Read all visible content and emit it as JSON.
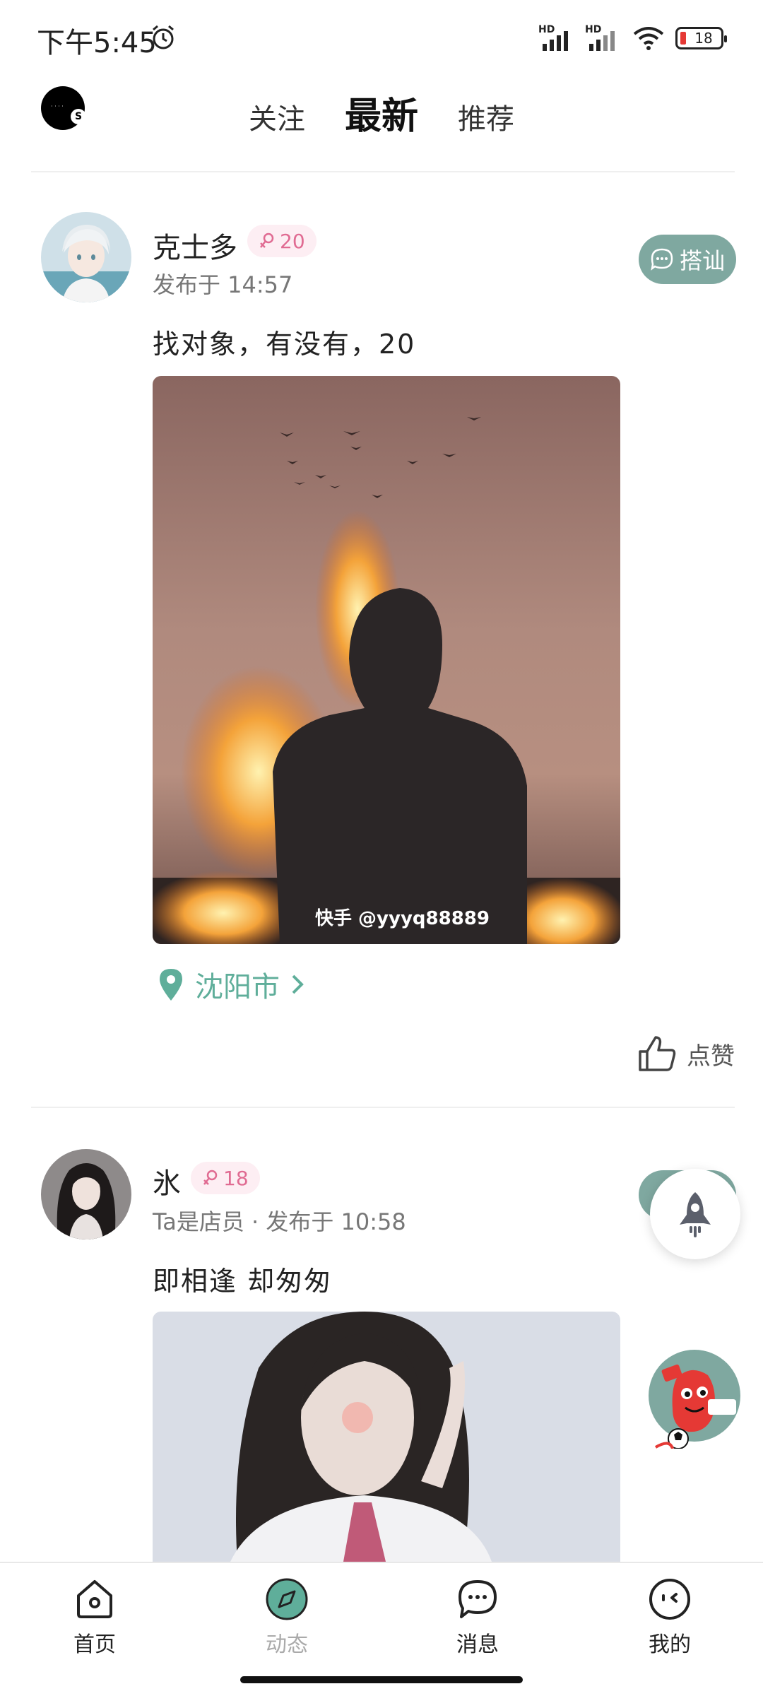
{
  "status_bar": {
    "time": "下午5:45",
    "signal_label_1": "HD",
    "signal_label_2": "HD",
    "battery": "18"
  },
  "top_nav": {
    "tabs": [
      {
        "label": "关注"
      },
      {
        "label": "最新"
      },
      {
        "label": "推荐"
      }
    ],
    "active_tab": "最新"
  },
  "posts": [
    {
      "username": "克士多",
      "age": "20",
      "meta": "发布于 14:57",
      "chat_label": "搭讪",
      "text": "找对象，有没有，20",
      "image_watermark": "快手 @yyyq88889",
      "location": "沈阳市",
      "like_label": "点赞"
    },
    {
      "username": "氷",
      "age": "18",
      "meta": "Ta是店员 · 发布于 10:58",
      "text": "即相逢 却匆匆"
    }
  ],
  "bottom_nav": [
    {
      "label": "首页",
      "icon": "home-icon"
    },
    {
      "label": "动态",
      "icon": "compass-icon"
    },
    {
      "label": "消息",
      "icon": "message-icon"
    },
    {
      "label": "我的",
      "icon": "profile-icon"
    }
  ],
  "colors": {
    "accent": "#7fa8a0",
    "location": "#5fae9a",
    "age_tag_bg": "#fdeef3",
    "age_tag_text": "#e06b92"
  }
}
